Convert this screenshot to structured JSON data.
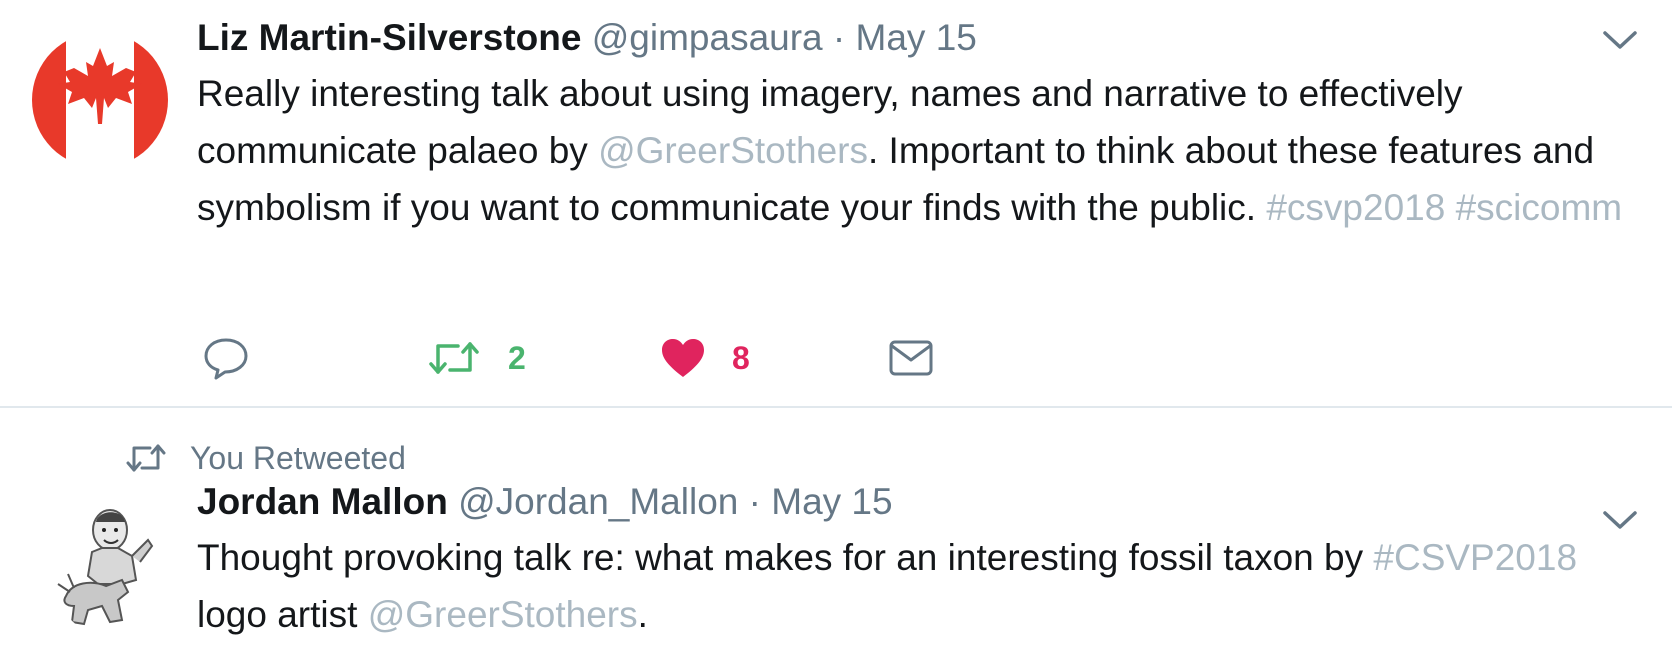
{
  "tweets": [
    {
      "author_name": "Liz Martin-Silverstone",
      "handle": "@gimpasaura",
      "separator": "·",
      "date": "May 15",
      "text_parts": [
        "Really interesting talk about using imagery, names and narrative to effectively communicate palaeo by ",
        "@GreerStothers",
        ". Important to think about these features and symbolism if you want to communicate your finds with the public. ",
        "#csvp2018",
        " ",
        "#scicomm"
      ],
      "avatar": "canadian-flag-bat-avatar",
      "actions": {
        "reply_icon": "reply-bubble-icon",
        "retweet_icon": "retweet-icon",
        "retweet_count": "2",
        "like_icon": "heart-icon",
        "like_count": "8",
        "dm_icon": "envelope-icon"
      }
    },
    {
      "social_context": "You Retweeted",
      "author_name": "Jordan Mallon",
      "handle": "@Jordan_Mallon",
      "separator": "·",
      "date": "May 15",
      "text_parts": [
        "Thought provoking talk re: what makes for an interesting fossil taxon by ",
        "#CSVP2018",
        " logo artist ",
        "@GreerStothers",
        "."
      ],
      "avatar": "caricature-dinosaur-avatar"
    }
  ],
  "colors": {
    "text": "#14171a",
    "secondary": "#657786",
    "link": "#aab8c2",
    "retweet_green": "#4ab46e",
    "like_red": "#e0245e",
    "flag_red": "#e8392a",
    "divider": "#e1e8ed"
  }
}
